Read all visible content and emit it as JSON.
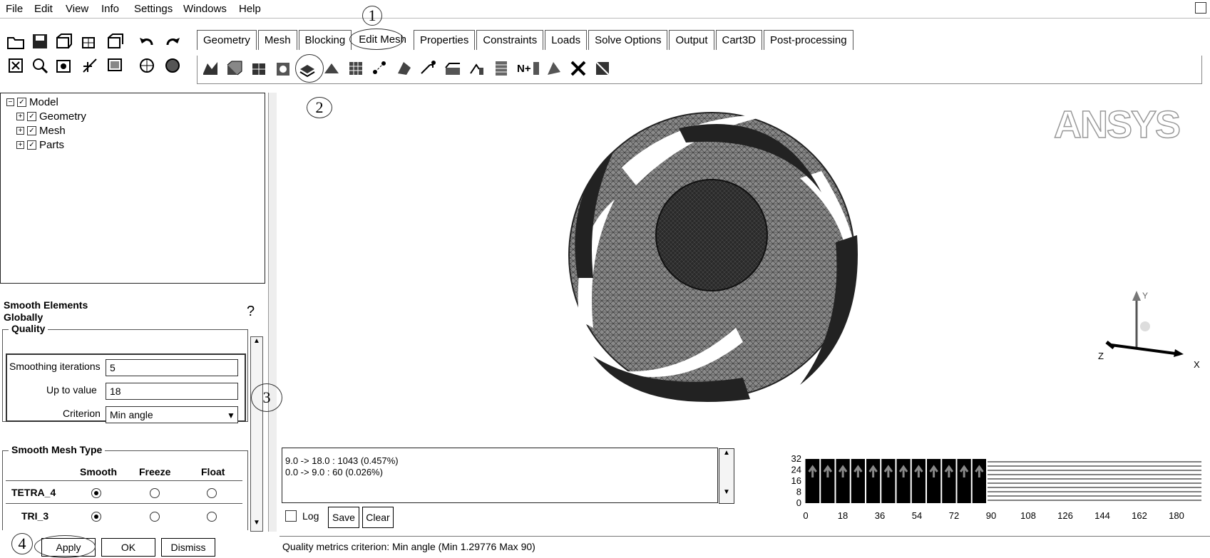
{
  "menu": {
    "file": "File",
    "edit": "Edit",
    "view": "View",
    "info": "Info",
    "settings": "Settings",
    "windows": "Windows",
    "help": "Help"
  },
  "tabs": [
    "Geometry",
    "Mesh",
    "Blocking",
    "Edit Mesh",
    "Properties",
    "Constraints",
    "Loads",
    "Solve Options",
    "Output",
    "Cart3D",
    "Post-processing"
  ],
  "tree": {
    "root": "Model",
    "items": [
      "Geometry",
      "Mesh",
      "Parts"
    ]
  },
  "panel": {
    "title": "Smooth Elements Globally",
    "quality_group": "Quality",
    "iterations_label": "Smoothing iterations",
    "iterations_value": "5",
    "upto_label": "Up to value",
    "upto_value": "18",
    "criterion_label": "Criterion",
    "criterion_value": "Min angle",
    "type_group": "Smooth Mesh Type",
    "col_smooth": "Smooth",
    "col_freeze": "Freeze",
    "col_float": "Float",
    "row1": "TETRA_4",
    "row2": "TRI_3",
    "apply": "Apply",
    "ok": "OK",
    "dismiss": "Dismiss"
  },
  "viewport": {
    "logo": "ANSYS",
    "axis_x": "X",
    "axis_y": "Y",
    "axis_z": "Z"
  },
  "messages": {
    "line1": "9.0 -> 18.0 : 1043 (0.457%)",
    "line2": "0.0 -> 9.0 : 60 (0.026%)",
    "log": "Log",
    "save": "Save",
    "clear": "Clear"
  },
  "histogram": {
    "y_ticks": [
      "32",
      "24",
      "16",
      "8",
      "0"
    ],
    "x_ticks": [
      "0",
      "18",
      "36",
      "54",
      "72",
      "90",
      "108",
      "126",
      "144",
      "162",
      "180"
    ],
    "bars": 12
  },
  "status": "Quality metrics criterion: Min angle (Min 1.29776 Max 90)",
  "annotations": {
    "c1": "1",
    "c2": "2",
    "c3": "3",
    "c4": "4"
  }
}
